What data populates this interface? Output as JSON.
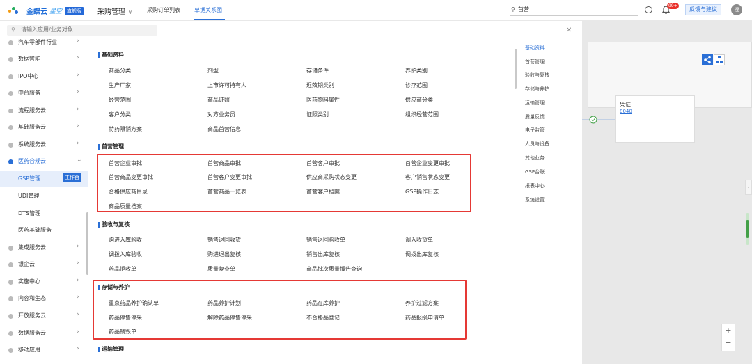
{
  "topbar": {
    "brand": "金蝶云",
    "brand_sub": "星空",
    "edition": "旗舰版",
    "module": "采购管理",
    "tabs": [
      "采购订单列表",
      "单据关系图"
    ],
    "search_value": "首营",
    "notif_count": "99+",
    "feedback": "反馈与建议",
    "avatar": "搜"
  },
  "panel": {
    "search_placeholder": "请输入应用/业务对象",
    "nav": [
      {
        "label": "汽车零部件行业"
      },
      {
        "label": "数据智能"
      },
      {
        "label": "IPO中心"
      },
      {
        "label": "中台服务"
      },
      {
        "label": "流程服务云"
      },
      {
        "label": "基础服务云"
      },
      {
        "label": "系统服务云"
      },
      {
        "label": "医药合规云"
      },
      {
        "label": "GSP管理",
        "tag": "工作台"
      },
      {
        "label": "UDI管理"
      },
      {
        "label": "DTS管理"
      },
      {
        "label": "医药基础服务"
      },
      {
        "label": "集成服务云"
      },
      {
        "label": "银企云"
      },
      {
        "label": "实施中心"
      },
      {
        "label": "内容和生态"
      },
      {
        "label": "开放服务云"
      },
      {
        "label": "数据服务云"
      },
      {
        "label": "移动应用"
      }
    ],
    "sections": {
      "s1": {
        "title": "基础资料",
        "items": [
          "商品分类",
          "剂型",
          "存储条件",
          "养护类别",
          "生产厂家",
          "上市许可持有人",
          "近效期类别",
          "诊疗范围",
          "经营范围",
          "商品证照",
          "医药物料属性",
          "供应商分类",
          "客户分类",
          "对方业务员",
          "证照类别",
          "组织经营范围",
          "特药限销方案",
          "商品首营信息"
        ]
      },
      "s2": {
        "title": "首营管理",
        "items": [
          "首营企业审批",
          "首营商品审批",
          "首营客户审批",
          "首营企业变更审批",
          "首营商品变更审批",
          "首营客户变更审批",
          "供应商采购状态变更",
          "客户销售状态变更",
          "合格供应商目录",
          "首营商品一览表",
          "首营客户档案",
          "GSP操作日志",
          "商品质量档案"
        ]
      },
      "s3": {
        "title": "验收与复核",
        "items": [
          "购进入库验收",
          "销售退回收货",
          "销售退回验收单",
          "调入收货单",
          "调拨入库验收",
          "购进退出复核",
          "销售出库复核",
          "调拨出库复核",
          "药品拒收单",
          "质量复查单",
          "商品批次质量报告查询"
        ]
      },
      "s4": {
        "title": "存储与养护",
        "items": [
          "重点药品养护确认单",
          "药品养护计划",
          "药品在库养护",
          "养护过滤方案",
          "药品停售停采",
          "解除药品停售停采",
          "不合格品登记",
          "药品报损申请单",
          "药品销毁单"
        ]
      },
      "s5": {
        "title": "运输管理"
      }
    },
    "anchors": [
      "基础资料",
      "首营管理",
      "验收与复核",
      "存储与养护",
      "运输管理",
      "质量反馈",
      "电子监管",
      "人员与设备",
      "其他业务",
      "GSP台账",
      "报表中心",
      "系统设置"
    ]
  },
  "background": {
    "flow_card_title": "凭证",
    "flow_card_no": "8040"
  },
  "colors": {
    "accent": "#2a6fd6",
    "highlight_box": "#e53935"
  }
}
